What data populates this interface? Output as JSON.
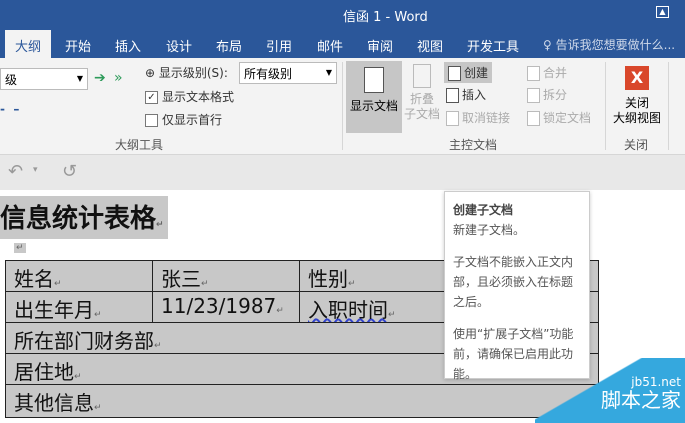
{
  "window": {
    "title": "信函 1 - Word",
    "restore_icon": "ribbon-display-icon"
  },
  "tabs": [
    "大纲",
    "开始",
    "插入",
    "设计",
    "布局",
    "引用",
    "邮件",
    "审阅",
    "视图",
    "开发工具"
  ],
  "tell_me": "告诉我您想要做什么...",
  "ribbon": {
    "level_select": "级",
    "show_level_label": "显示级别(S):",
    "show_level_value": "所有级别",
    "show_text_format": "显示文本格式",
    "show_text_format_checked": true,
    "show_first_line": "仅显示首行",
    "show_first_line_checked": false,
    "outline_tools": "大纲工具",
    "show_document": "显示文档",
    "collapse_sub": [
      "折叠",
      "子文档"
    ],
    "create": "创建",
    "insert": "插入",
    "unlink": "取消链接",
    "merge": "合并",
    "split": "拆分",
    "lock": "锁定文档",
    "master_doc": "主控文档",
    "close_outline": [
      "关闭",
      "大纲视图"
    ],
    "close_group": "关闭"
  },
  "document": {
    "heading": "信息统计表格",
    "rows": [
      [
        "姓名",
        "张三",
        "性别"
      ],
      [
        "出生年月",
        "11/23/1987",
        "入职时间"
      ],
      [
        "所在部门财务部"
      ],
      [
        "居住地"
      ],
      [
        "其他信息"
      ]
    ]
  },
  "tooltip": {
    "title": "创建子文档",
    "line1": "新建子文档。",
    "line2": "子文档不能嵌入正文内部，且必须嵌入在标题之后。",
    "line3": "使用“扩展子文档”功能前，请确保已启用此功能。"
  },
  "watermark": {
    "site": "jb51.net",
    "name": "脚本之家"
  }
}
